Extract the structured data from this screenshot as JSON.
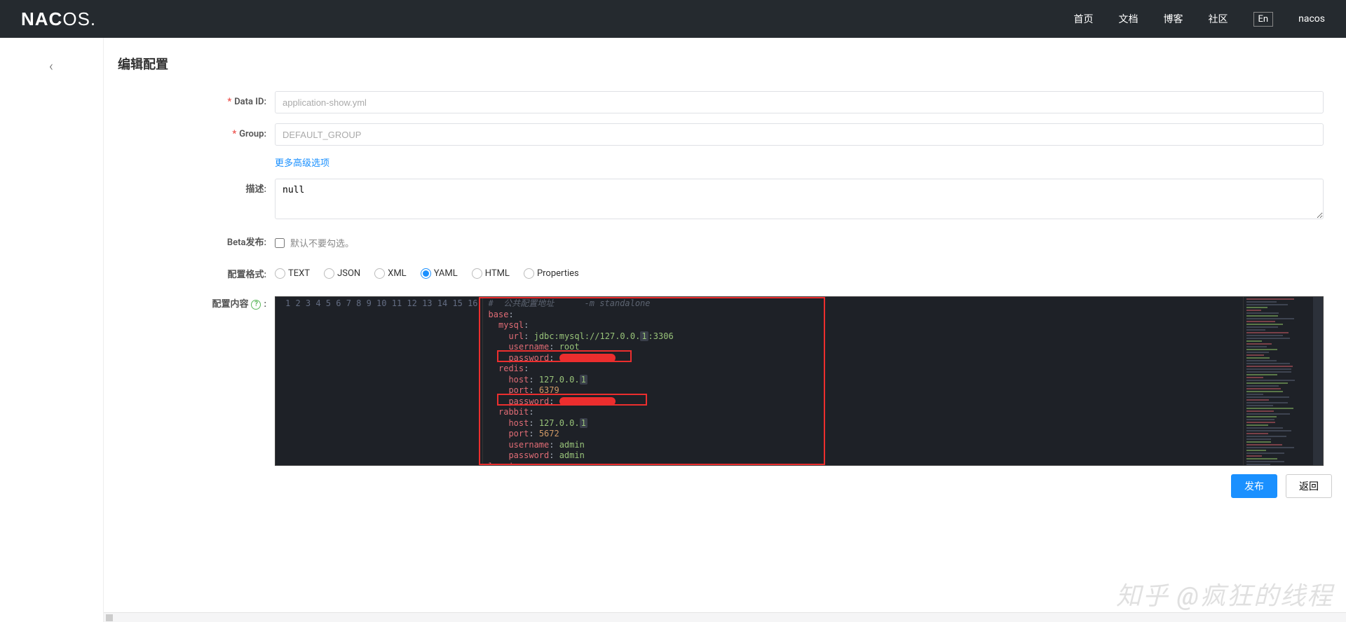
{
  "header": {
    "logo_html": "NACOS.",
    "nav": {
      "home": "首页",
      "docs": "文档",
      "blog": "博客",
      "community": "社区",
      "lang": "En",
      "user": "nacos"
    }
  },
  "page": {
    "title": "编辑配置",
    "labels": {
      "data_id": "Data ID:",
      "group": "Group:",
      "advanced": "更多高级选项",
      "desc": "描述:",
      "beta": "Beta发布:",
      "beta_tip": "默认不要勾选。",
      "format": "配置格式:",
      "content": "配置内容"
    },
    "data_id": "application-show.yml",
    "group": "DEFAULT_GROUP",
    "desc": "null",
    "formats": [
      "TEXT",
      "JSON",
      "XML",
      "YAML",
      "HTML",
      "Properties"
    ],
    "selected_format": "YAML",
    "buttons": {
      "publish": "发布",
      "back": "返回"
    }
  },
  "editor": {
    "comment_line": "#  公共配置地址      -m standalone",
    "lines": [
      {
        "kw": "base",
        "rest": ":"
      },
      {
        "kw": "mysql",
        "rest": ":",
        "indent": 1
      },
      {
        "kw": "url",
        "rest": ": ",
        "str": "jdbc:mysql://127.0.0.1:3306",
        "hl": "1",
        "indent": 2
      },
      {
        "kw": "username",
        "rest": ": ",
        "str": "root",
        "indent": 2
      },
      {
        "kw": "password",
        "rest": ": ",
        "redact": true,
        "indent": 2
      },
      {
        "kw": "redis",
        "rest": ":",
        "indent": 1
      },
      {
        "kw": "host",
        "rest": ": ",
        "str": "127.0.0.1",
        "hl": "1",
        "indent": 2
      },
      {
        "kw": "port",
        "rest": ": ",
        "num": "6379",
        "indent": 2
      },
      {
        "kw": "password",
        "rest": ": ",
        "redact": true,
        "indent": 2
      },
      {
        "kw": "rabbit",
        "rest": ":",
        "indent": 1
      },
      {
        "kw": "host",
        "rest": ": ",
        "str": "127.0.0.1",
        "hl": "1",
        "indent": 2
      },
      {
        "kw": "port",
        "rest": ": ",
        "num": "5672",
        "indent": 2
      },
      {
        "kw": "username",
        "rest": ": ",
        "str": "admin",
        "indent": 2
      },
      {
        "kw": "password",
        "rest": ": ",
        "str": "admin",
        "indent": 2
      },
      {
        "kw": "logging",
        "rest": ":"
      }
    ]
  },
  "watermark": "知乎  @疯狂的线程"
}
